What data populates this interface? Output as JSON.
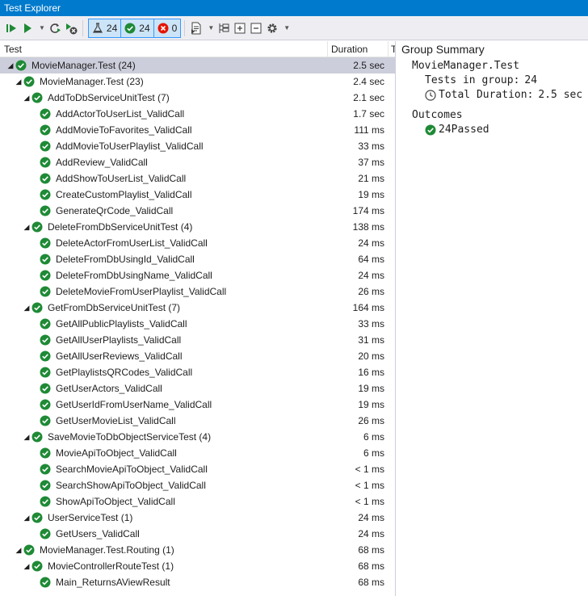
{
  "window": {
    "title": "Test Explorer"
  },
  "toolbar": {
    "total_count": "24",
    "passed_count": "24",
    "failed_count": "0",
    "icons": [
      "run-all-icon",
      "run-icon",
      "refresh-icon",
      "cancel-icon",
      "flask-icon",
      "passed-icon",
      "failed-icon",
      "playlist-icon",
      "hierarchy-icon",
      "expand-all-icon",
      "collapse-all-icon",
      "settings-icon"
    ]
  },
  "columns": {
    "test": "Test",
    "duration": "Duration",
    "truncated": "T"
  },
  "rows": [
    {
      "name": "MovieManager.Test (24)",
      "duration": "2.5 sec",
      "level": 0,
      "group": true,
      "selected": true
    },
    {
      "name": "MovieManager.Test (23)",
      "duration": "2.4 sec",
      "level": 1,
      "group": true
    },
    {
      "name": "AddToDbServiceUnitTest (7)",
      "duration": "2.1 sec",
      "level": 2,
      "group": true
    },
    {
      "name": "AddActorToUserList_ValidCall",
      "duration": "1.7 sec",
      "level": 3
    },
    {
      "name": "AddMovieToFavorites_ValidCall",
      "duration": "111 ms",
      "level": 3
    },
    {
      "name": "AddMovieToUserPlaylist_ValidCall",
      "duration": "33 ms",
      "level": 3
    },
    {
      "name": "AddReview_ValidCall",
      "duration": "37 ms",
      "level": 3
    },
    {
      "name": "AddShowToUserList_ValidCall",
      "duration": "21 ms",
      "level": 3
    },
    {
      "name": "CreateCustomPlaylist_ValidCall",
      "duration": "19 ms",
      "level": 3
    },
    {
      "name": "GenerateQrCode_ValidCall",
      "duration": "174 ms",
      "level": 3
    },
    {
      "name": "DeleteFromDbServiceUnitTest (4)",
      "duration": "138 ms",
      "level": 2,
      "group": true
    },
    {
      "name": "DeleteActorFromUserList_ValidCall",
      "duration": "24 ms",
      "level": 3
    },
    {
      "name": "DeleteFromDbUsingId_ValidCall",
      "duration": "64 ms",
      "level": 3
    },
    {
      "name": "DeleteFromDbUsingName_ValidCall",
      "duration": "24 ms",
      "level": 3
    },
    {
      "name": "DeleteMovieFromUserPlaylist_ValidCall",
      "duration": "26 ms",
      "level": 3
    },
    {
      "name": "GetFromDbServiceUnitTest (7)",
      "duration": "164 ms",
      "level": 2,
      "group": true
    },
    {
      "name": "GetAllPublicPlaylists_ValidCall",
      "duration": "33 ms",
      "level": 3
    },
    {
      "name": "GetAllUserPlaylists_ValidCall",
      "duration": "31 ms",
      "level": 3
    },
    {
      "name": "GetAllUserReviews_ValidCall",
      "duration": "20 ms",
      "level": 3
    },
    {
      "name": "GetPlaylistsQRCodes_ValidCall",
      "duration": "16 ms",
      "level": 3
    },
    {
      "name": "GetUserActors_ValidCall",
      "duration": "19 ms",
      "level": 3
    },
    {
      "name": "GetUserIdFromUserName_ValidCall",
      "duration": "19 ms",
      "level": 3
    },
    {
      "name": "GetUserMovieList_ValidCall",
      "duration": "26 ms",
      "level": 3
    },
    {
      "name": "SaveMovieToDbObjectServiceTest (4)",
      "duration": "6 ms",
      "level": 2,
      "group": true
    },
    {
      "name": "MovieApiToObject_ValidCall",
      "duration": "6 ms",
      "level": 3
    },
    {
      "name": "SearchMovieApiToObject_ValidCall",
      "duration": "< 1 ms",
      "level": 3
    },
    {
      "name": "SearchShowApiToObject_ValidCall",
      "duration": "< 1 ms",
      "level": 3
    },
    {
      "name": "ShowApiToObject_ValidCall",
      "duration": "< 1 ms",
      "level": 3
    },
    {
      "name": "UserServiceTest (1)",
      "duration": "24 ms",
      "level": 2,
      "group": true
    },
    {
      "name": "GetUsers_ValidCall",
      "duration": "24 ms",
      "level": 3
    },
    {
      "name": "MovieManager.Test.Routing (1)",
      "duration": "68 ms",
      "level": 1,
      "group": true
    },
    {
      "name": "MovieControllerRouteTest (1)",
      "duration": "68 ms",
      "level": 2,
      "group": true
    },
    {
      "name": "Main_ReturnsAViewResult",
      "duration": "68 ms",
      "level": 3
    }
  ],
  "summary": {
    "title": "Group Summary",
    "group_name": "MovieManager.Test",
    "tests_label": "Tests in group:",
    "tests_value": "24",
    "duration_label": "Total Duration:",
    "duration_value": "2.5 sec",
    "outcomes_label": "Outcomes",
    "passed_count": "24",
    "passed_label": "Passed"
  },
  "colors": {
    "accent": "#007acc",
    "pass": "#1e8a35",
    "fail": "#e51400",
    "selected_row": "#cccedb"
  }
}
